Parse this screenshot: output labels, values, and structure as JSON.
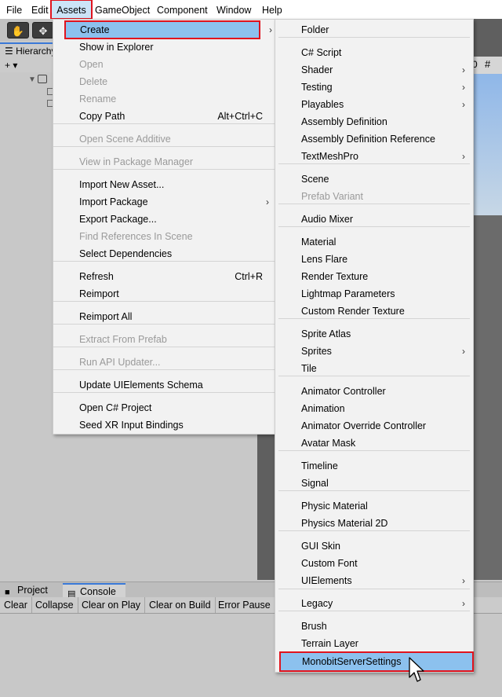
{
  "menubar": {
    "items": [
      "File",
      "Edit",
      "Assets",
      "GameObject",
      "Component",
      "Window",
      "Help"
    ]
  },
  "hierarchy": {
    "tab_label": "Hierarchy",
    "add_label": "+ ▾"
  },
  "bottom": {
    "tabs": [
      "Project",
      "Console"
    ],
    "console_buttons": [
      "Clear",
      "Collapse",
      "Clear on Play",
      "Clear on Build",
      "Error Pause"
    ]
  },
  "assets_menu": {
    "items": [
      {
        "label": "Create"
      },
      {
        "label": "Show in Explorer"
      },
      {
        "label": "Open"
      },
      {
        "label": "Delete"
      },
      {
        "label": "Rename"
      },
      {
        "label": "Copy Path",
        "shortcut": "Alt+Ctrl+C"
      },
      {
        "label": "Open Scene Additive"
      },
      {
        "label": "View in Package Manager"
      },
      {
        "label": "Import New Asset..."
      },
      {
        "label": "Import Package"
      },
      {
        "label": "Export Package..."
      },
      {
        "label": "Find References In Scene"
      },
      {
        "label": "Select Dependencies"
      },
      {
        "label": "Refresh",
        "shortcut": "Ctrl+R"
      },
      {
        "label": "Reimport"
      },
      {
        "label": "Reimport All"
      },
      {
        "label": "Extract From Prefab"
      },
      {
        "label": "Run API Updater..."
      },
      {
        "label": "Update UIElements Schema"
      },
      {
        "label": "Open C# Project"
      },
      {
        "label": "Seed XR Input Bindings"
      }
    ]
  },
  "create_menu": {
    "items": [
      {
        "label": "Folder"
      },
      {
        "label": "C# Script"
      },
      {
        "label": "Shader"
      },
      {
        "label": "Testing"
      },
      {
        "label": "Playables"
      },
      {
        "label": "Assembly Definition"
      },
      {
        "label": "Assembly Definition Reference"
      },
      {
        "label": "TextMeshPro"
      },
      {
        "label": "Scene"
      },
      {
        "label": "Prefab Variant"
      },
      {
        "label": "Audio Mixer"
      },
      {
        "label": "Material"
      },
      {
        "label": "Lens Flare"
      },
      {
        "label": "Render Texture"
      },
      {
        "label": "Lightmap Parameters"
      },
      {
        "label": "Custom Render Texture"
      },
      {
        "label": "Sprite Atlas"
      },
      {
        "label": "Sprites"
      },
      {
        "label": "Tile"
      },
      {
        "label": "Animator Controller"
      },
      {
        "label": "Animation"
      },
      {
        "label": "Animator Override Controller"
      },
      {
        "label": "Avatar Mask"
      },
      {
        "label": "Timeline"
      },
      {
        "label": "Signal"
      },
      {
        "label": "Physic Material"
      },
      {
        "label": "Physics Material 2D"
      },
      {
        "label": "GUI Skin"
      },
      {
        "label": "Custom Font"
      },
      {
        "label": "UIElements"
      },
      {
        "label": "Legacy"
      },
      {
        "label": "Brush"
      },
      {
        "label": "Terrain Layer"
      },
      {
        "label": "MonobitServerSettings"
      }
    ]
  },
  "arrow_glyph": "›",
  "colors": {
    "highlight": "#8cc1ee",
    "annotation": "#e0141e",
    "menu_bg": "#f2f2f2"
  }
}
